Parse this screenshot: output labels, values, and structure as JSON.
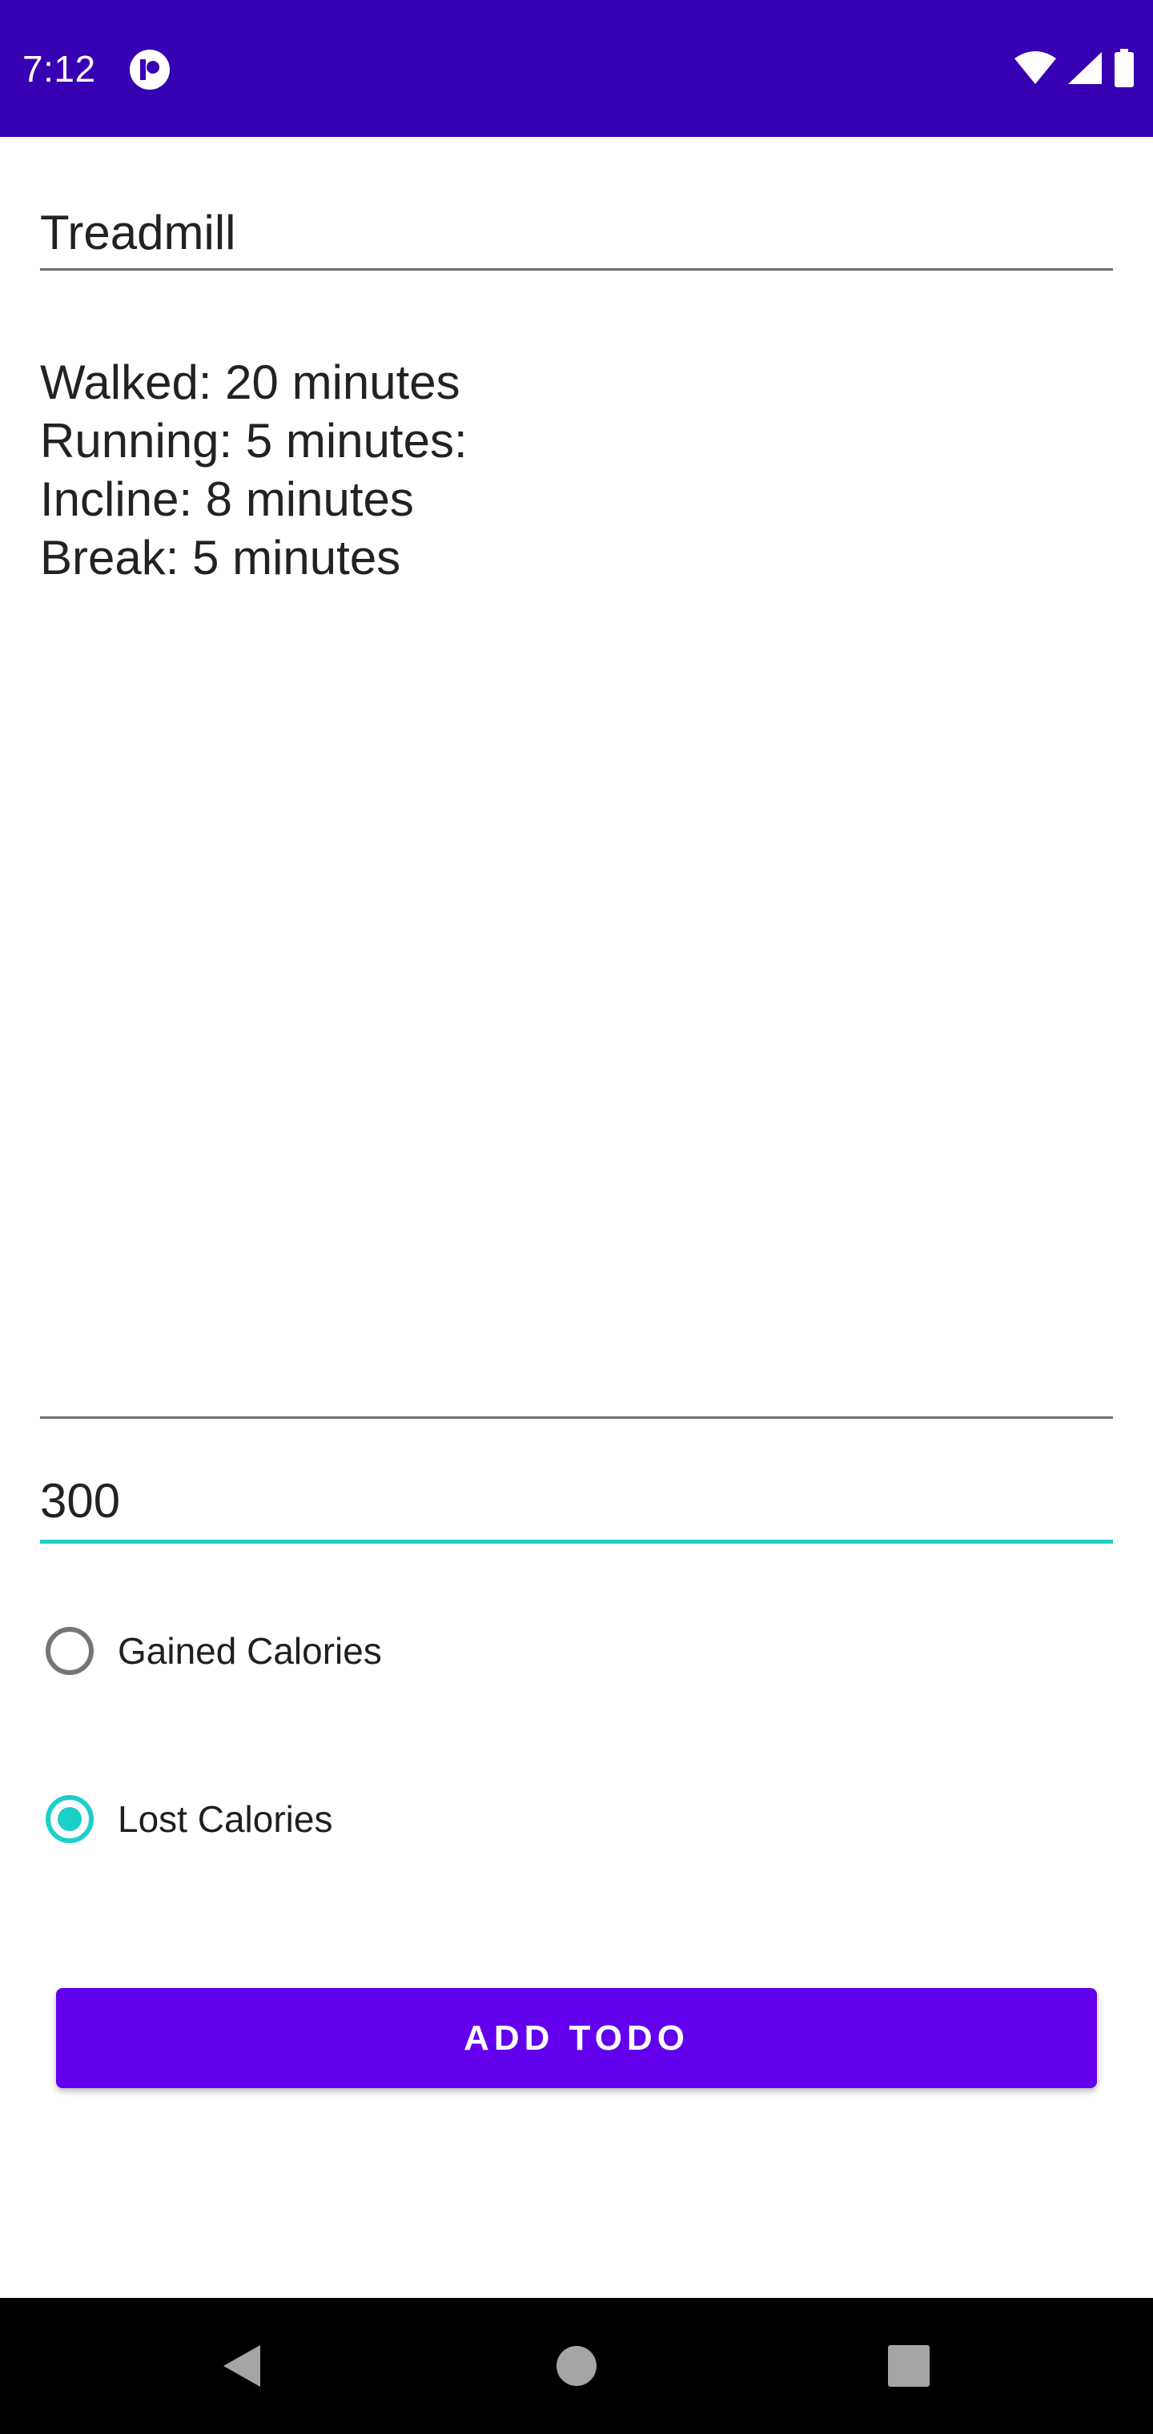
{
  "status_bar": {
    "time": "7:12",
    "icons": [
      "app-notification-icon",
      "wifi-icon",
      "cell-signal-icon",
      "battery-icon"
    ],
    "background": "#3700b3"
  },
  "form": {
    "title_value": "Treadmill",
    "description_lines": [
      "Walked: 20 minutes",
      "Running: 5 minutes:",
      "Incline: 8 minutes",
      "Break: 5 minutes"
    ],
    "calories_value": "300",
    "radio_options": [
      {
        "label": "Gained Calories",
        "checked": false
      },
      {
        "label": "Lost Calories",
        "checked": true
      }
    ]
  },
  "actions": {
    "add_label": "ADD TODO"
  },
  "nav_bar": {
    "icons": [
      "back-icon",
      "home-icon",
      "recents-icon"
    ]
  },
  "colors": {
    "primary": "#6200ee",
    "primary_dark": "#3700b3",
    "accent": "#1ccfc9"
  }
}
